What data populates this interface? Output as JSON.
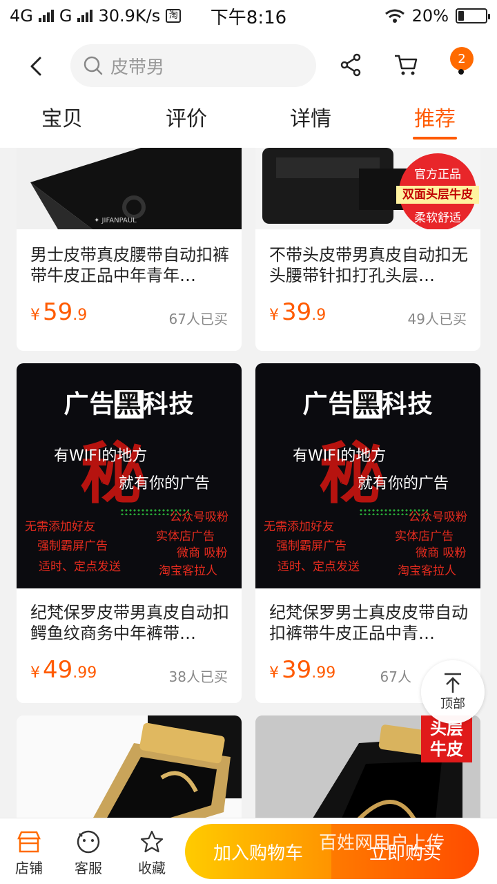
{
  "status": {
    "left_text": "4G",
    "g_text": "G",
    "speed": "30.9K/s",
    "time": "下午8:16",
    "battery": "20%"
  },
  "header": {
    "search_placeholder": "皮带男",
    "cart_badge": "2",
    "icons": [
      "back-icon",
      "search-icon",
      "share-icon",
      "cart-icon"
    ]
  },
  "tabs": [
    {
      "label": "宝贝",
      "active": false
    },
    {
      "label": "评价",
      "active": false
    },
    {
      "label": "详情",
      "active": false
    },
    {
      "label": "推荐",
      "active": true
    }
  ],
  "products": [
    {
      "title": "男士皮带真皮腰带自动扣裤带牛皮正品中年青年…",
      "currency": "¥",
      "price_int": "59",
      "price_dec": ".9",
      "sold": "67人已买"
    },
    {
      "title": "不带头皮带男真皮自动扣无头腰带针扣打孔头层…",
      "currency": "¥",
      "price_int": "39",
      "price_dec": ".9",
      "sold": "49人已买"
    },
    {
      "title": "纪梵保罗皮带男真皮自动扣鳄鱼纹商务中年裤带…",
      "currency": "¥",
      "price_int": "49",
      "price_dec": ".99",
      "sold": "38人已买"
    },
    {
      "title": "纪梵保罗男士真皮皮带自动扣裤带牛皮正品中青…",
      "currency": "¥",
      "price_int": "39",
      "price_dec": ".99",
      "sold": "67人"
    }
  ],
  "stamp": {
    "top": "官方正品",
    "mid": "双面头层牛皮",
    "bottom": "柔软舒适"
  },
  "ad": {
    "head_a": "广告",
    "head_hl": "黑",
    "head_b": "科技",
    "mi": "秘",
    "line1": "有WIFI的地方",
    "line2": "就有你的广告",
    "r1": "无需添加好友",
    "r2": "强制霸屏广告",
    "r3": "适时、定点发送",
    "r4": "公众号吸粉",
    "r5": "实体店广告",
    "r6": "微商 吸粉",
    "r7": "淘宝客拉人"
  },
  "card6_tag": "头层\n牛皮",
  "totop_label": "顶部",
  "bottom": {
    "shop": "店铺",
    "service": "客服",
    "fav": "收藏",
    "add_cart": "加入购物车",
    "buy_now": "立即购买",
    "watermark": "百姓网用户上传"
  },
  "colors": {
    "accent": "#ff5a00",
    "cart_start": "#ffcb00",
    "buy_end": "#ff4c00"
  }
}
